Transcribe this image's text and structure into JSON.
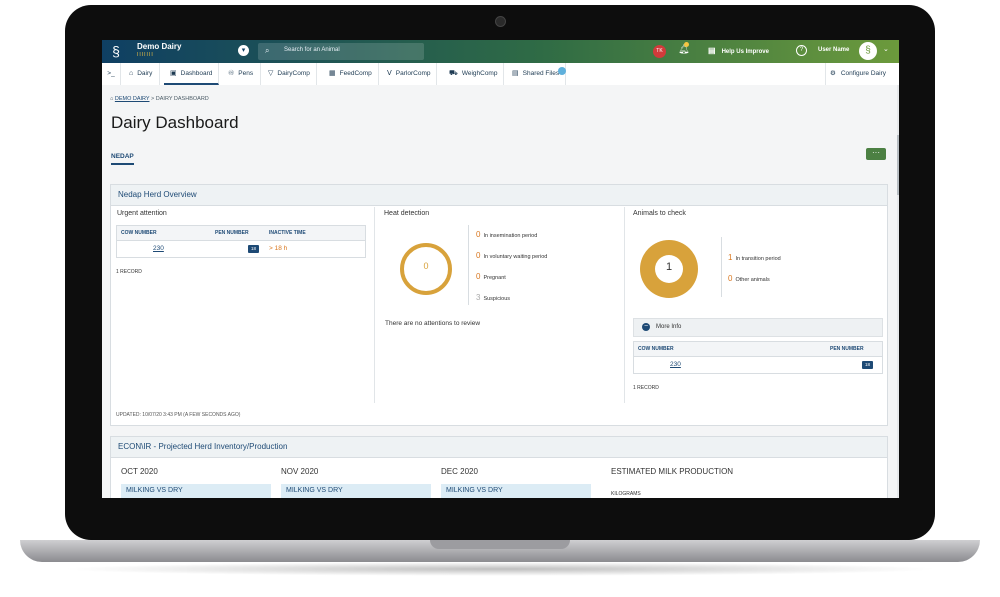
{
  "topbar": {
    "dairy_name": "Demo Dairy",
    "dairy_sub": "IIIIIII",
    "search_placeholder": "Search for an Animal",
    "notif_badge": "TK",
    "help": "Help Us Improve",
    "user_name": "User Name"
  },
  "nav": {
    "items": [
      {
        "icon": "home-icon",
        "label": "Dairy"
      },
      {
        "icon": "dashboard-icon",
        "label": "Dashboard"
      },
      {
        "icon": "pens-icon",
        "label": "Pens"
      },
      {
        "icon": "dairycomp-icon",
        "label": "DairyComp"
      },
      {
        "icon": "feedcomp-icon",
        "label": "FeedComp"
      },
      {
        "icon": "parlorcomp-icon",
        "label": "ParlorComp"
      },
      {
        "icon": "weighcomp-icon",
        "label": "WeighComp"
      },
      {
        "icon": "shared-files-icon",
        "label": "Shared Files"
      }
    ],
    "active": "Dashboard",
    "configure": "Configure Dairy"
  },
  "breadcrumb": {
    "root": "DEMO DAIRY",
    "sep": ">",
    "current": "DAIRY DASHBOARD"
  },
  "page_title": "Dairy Dashboard",
  "subtab": "NEDAP",
  "more_button": "···",
  "nedap": {
    "title": "Nedap Herd Overview",
    "urgent": {
      "title": "Urgent attention",
      "headers": [
        "COW NUMBER",
        "PEN NUMBER",
        "INACTIVE TIME"
      ],
      "rows": [
        {
          "cow": "230",
          "pen": "18",
          "inactive": "> 18 h"
        }
      ],
      "record": "1 RECORD"
    },
    "heat": {
      "title": "Heat detection",
      "donut_value": "0",
      "stats": [
        {
          "n": "0",
          "label": "In insemination period"
        },
        {
          "n": "0",
          "label": "In voluntary waiting period"
        },
        {
          "n": "0",
          "label": "Pregnant"
        },
        {
          "n": "3",
          "label": "Suspicious"
        }
      ],
      "note": "There are no attentions to review"
    },
    "check": {
      "title": "Animals to check",
      "donut_value": "1",
      "stats": [
        {
          "n": "1",
          "label": "In transition period"
        },
        {
          "n": "0",
          "label": "Other animals"
        }
      ],
      "more_info": "More Info",
      "headers": [
        "COW NUMBER",
        "PEN NUMBER"
      ],
      "rows": [
        {
          "cow": "230",
          "pen": "18"
        }
      ],
      "record": "1 RECORD"
    },
    "updated": "UPDATED: 10/07/20 3:43 PM (A FEW SECONDS AGO)"
  },
  "econ": {
    "title": "ECON\\IR - Projected Herd Inventory/Production",
    "months": [
      "OCT 2020",
      "NOV 2020",
      "DEC 2020"
    ],
    "subheader": "MILKING VS DRY",
    "milk_title": "ESTIMATED MILK PRODUCTION",
    "unit": "KILOGRAMS"
  },
  "colors": {
    "accent": "#1e4a75",
    "gold": "#d8a23b",
    "green": "#4c8043"
  }
}
